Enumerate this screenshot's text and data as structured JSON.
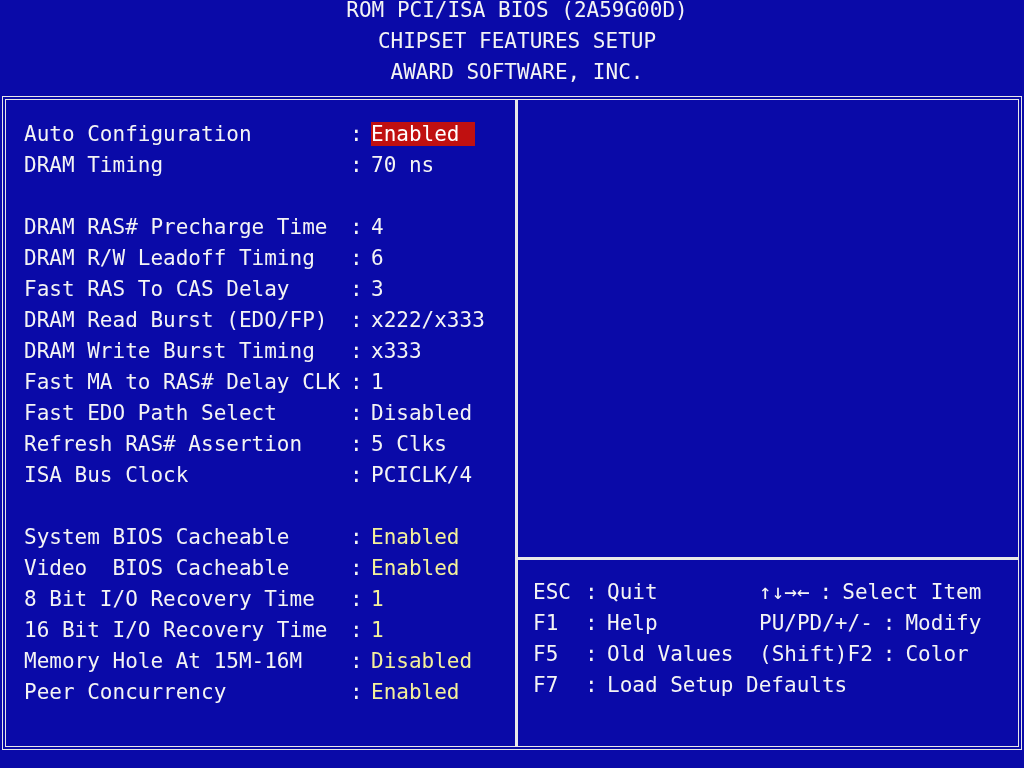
{
  "header": {
    "lines": [
      "ROM PCI/ISA BIOS (2A59G00D)",
      "CHIPSET FEATURES SETUP",
      "AWARD SOFTWARE, INC."
    ]
  },
  "setting_groups": [
    [
      {
        "label": "Auto Configuration",
        "value": "Enabled",
        "selected": true,
        "editable": false
      },
      {
        "label": "DRAM Timing",
        "value": "70 ns",
        "selected": false,
        "editable": false
      }
    ],
    [
      {
        "label": "DRAM RAS# Precharge Time",
        "value": "4",
        "selected": false,
        "editable": false
      },
      {
        "label": "DRAM R/W Leadoff Timing",
        "value": "6",
        "selected": false,
        "editable": false
      },
      {
        "label": "Fast RAS To CAS Delay",
        "value": "3",
        "selected": false,
        "editable": false
      },
      {
        "label": "DRAM Read Burst (EDO/FP)",
        "value": "x222/x333",
        "selected": false,
        "editable": false
      },
      {
        "label": "DRAM Write Burst Timing",
        "value": "x333",
        "selected": false,
        "editable": false
      },
      {
        "label": "Fast MA to RAS# Delay CLK",
        "value": "1",
        "selected": false,
        "editable": false
      },
      {
        "label": "Fast EDO Path Select",
        "value": "Disabled",
        "selected": false,
        "editable": false
      },
      {
        "label": "Refresh RAS# Assertion",
        "value": "5 Clks",
        "selected": false,
        "editable": false
      },
      {
        "label": "ISA Bus Clock",
        "value": "PCICLK/4",
        "selected": false,
        "editable": false
      }
    ],
    [
      {
        "label": "System BIOS Cacheable",
        "value": "Enabled",
        "selected": false,
        "editable": true
      },
      {
        "label": "Video  BIOS Cacheable",
        "value": "Enabled",
        "selected": false,
        "editable": true
      },
      {
        "label": "8 Bit I/O Recovery Time",
        "value": "1",
        "selected": false,
        "editable": true
      },
      {
        "label": "16 Bit I/O Recovery Time",
        "value": "1",
        "selected": false,
        "editable": true
      },
      {
        "label": "Memory Hole At 15M-16M",
        "value": "Disabled",
        "selected": false,
        "editable": true
      },
      {
        "label": "Peer Concurrency",
        "value": "Enabled",
        "selected": false,
        "editable": true
      }
    ]
  ],
  "separator": ":",
  "key_legend": [
    {
      "key": "ESC",
      "action": "Quit",
      "key_2": "↑↓→←",
      "action_2": "Select Item"
    },
    {
      "key": "F1",
      "action": "Help",
      "key_2": "PU/PD/+/-",
      "action_2": "Modify"
    },
    {
      "key": "F5",
      "action": "Old Values",
      "key_2": "(Shift)F2",
      "action_2": "Color"
    },
    {
      "key": "F7",
      "action": "Load Setup Defaults"
    }
  ]
}
